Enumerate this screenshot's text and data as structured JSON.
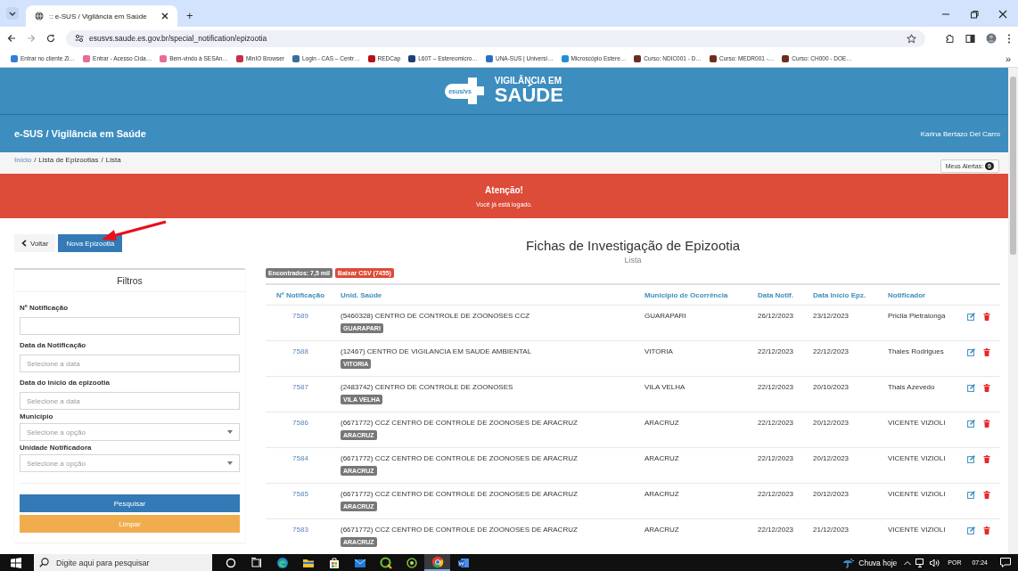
{
  "browser": {
    "tab": {
      "title": ":: e-SUS / Vigilância em Saúde",
      "selected": true
    },
    "new_tab": "+",
    "url": "esusvs.saude.es.gov.br/special_notification/epizootia",
    "bookmarks": [
      {
        "label": "Entrar no cliente Zi…",
        "color": "#2f7fd8"
      },
      {
        "label": "Entrar - Acesso Cida…",
        "color": "#e86a9a"
      },
      {
        "label": "Bem-vindo à SESAn…",
        "color": "#e86a9a"
      },
      {
        "label": "MinIO Browser",
        "color": "#c72e49"
      },
      {
        "label": "Login - CAS – Centr…",
        "color": "#3a6e9c"
      },
      {
        "label": "REDCap",
        "color": "#b5121b"
      },
      {
        "label": "L60T – Estereomicro…",
        "color": "#1f3f7a"
      },
      {
        "label": "UNA-SUS | Universi…",
        "color": "#2a6fbf"
      },
      {
        "label": "Microscópio Estere…",
        "color": "#1f8fd8"
      },
      {
        "label": "Curso: NDIC001 - D…",
        "color": "#6b2e1f"
      },
      {
        "label": "Curso: MEDR001 -…",
        "color": "#6b2e1f"
      },
      {
        "label": "Curso: CH000 - DOE…",
        "color": "#6b2e1f"
      }
    ],
    "more": "»"
  },
  "header": {
    "logo_mark": "esus/vs",
    "brand_top": "VIGILÂNCIA EM",
    "brand_bottom": "SAÚDE"
  },
  "navbar": {
    "title": "e-SUS / Vigilância em Saúde",
    "user": "Karina Bertazo Del Carro"
  },
  "breadcrumb": {
    "separator": "/",
    "items": [
      {
        "label": "Início",
        "link": true
      },
      {
        "label": "Lista de Epizootias",
        "link": false
      },
      {
        "label": "Lista",
        "link": false
      }
    ]
  },
  "alerts_button": {
    "label": "Meus Alertas:",
    "count": "0"
  },
  "alert": {
    "title": "Atenção!",
    "message": "Você já está logado."
  },
  "actions": [
    {
      "label": "Voltar",
      "kind": "back"
    },
    {
      "label": "Nova Epizootia",
      "kind": "primary"
    }
  ],
  "annotation": {
    "kind": "arrow"
  },
  "filters": {
    "title": "Filtros",
    "fields": [
      {
        "label": "Nº Notificação",
        "kind": "text"
      },
      {
        "label": "Data da Notificação",
        "kind": "date",
        "placeholder": "Selecione a data"
      },
      {
        "label": "Data do início da epizootia",
        "kind": "date",
        "placeholder": "Selecione a data"
      },
      {
        "label": "Município",
        "kind": "select",
        "placeholder": "Selecione a opção"
      },
      {
        "label": "Unidade Notificadora",
        "kind": "select",
        "placeholder": "Selecione a opção"
      }
    ],
    "buttons": [
      {
        "label": "Pesquisar",
        "kind": "primary"
      },
      {
        "label": "Limpar",
        "kind": "warning"
      }
    ]
  },
  "page_title": "Fichas de Investigação de Epizootia",
  "page_subtitle": "Lista",
  "badges": [
    {
      "label": "Encontrados: 7,5 mil",
      "kind": "count"
    },
    {
      "label": "Baixar CSV (7455)",
      "kind": "download"
    }
  ],
  "table": {
    "columns": [
      "Nº Notificação",
      "Unid. Saúde",
      "Municipio de Ocorrência",
      "Data Notif.",
      "Data Início Epz.",
      "Notificador"
    ],
    "rows": [
      {
        "number": "7589",
        "unit": "(5460328) CENTRO DE CONTROLE DE ZOONOSES CCZ",
        "tag": "GUARAPARI",
        "municipality": "GUARAPARI",
        "notified": "26/12/2023",
        "started": "23/12/2023",
        "notifier": "Pricila Pietralonga"
      },
      {
        "number": "7588",
        "unit": "(12467) CENTRO DE VIGILANCIA EM SAUDE AMBIENTAL",
        "tag": "VITORIA",
        "municipality": "VITORIA",
        "notified": "22/12/2023",
        "started": "22/12/2023",
        "notifier": "Thales Rodrigues"
      },
      {
        "number": "7587",
        "unit": "(2483742) CENTRO DE CONTROLE DE ZOONOSES",
        "tag": "VILA VELHA",
        "municipality": "VILA VELHA",
        "notified": "22/12/2023",
        "started": "20/10/2023",
        "notifier": "Thais Azevedo"
      },
      {
        "number": "7586",
        "unit": "(6671772) CCZ CENTRO DE CONTROLE DE ZOONOSES DE ARACRUZ",
        "tag": "ARACRUZ",
        "municipality": "ARACRUZ",
        "notified": "22/12/2023",
        "started": "20/12/2023",
        "notifier": "VICENTE VIZIOLI"
      },
      {
        "number": "7584",
        "unit": "(6671772) CCZ CENTRO DE CONTROLE DE ZOONOSES DE ARACRUZ",
        "tag": "ARACRUZ",
        "municipality": "ARACRUZ",
        "notified": "22/12/2023",
        "started": "20/12/2023",
        "notifier": "VICENTE VIZIOLI"
      },
      {
        "number": "7585",
        "unit": "(6671772) CCZ CENTRO DE CONTROLE DE ZOONOSES DE ARACRUZ",
        "tag": "ARACRUZ",
        "municipality": "ARACRUZ",
        "notified": "22/12/2023",
        "started": "20/12/2023",
        "notifier": "VICENTE VIZIOLI"
      },
      {
        "number": "7583",
        "unit": "(6671772) CCZ CENTRO DE CONTROLE DE ZOONOSES DE ARACRUZ",
        "tag": "ARACRUZ",
        "municipality": "ARACRUZ",
        "notified": "22/12/2023",
        "started": "21/12/2023",
        "notifier": "VICENTE VIZIOLI"
      }
    ]
  },
  "taskbar": {
    "search_placeholder": "Digite aqui para pesquisar",
    "apps": [
      {
        "kind": "circle",
        "selected": false
      },
      {
        "kind": "taskview",
        "selected": false
      },
      {
        "kind": "edge",
        "selected": false
      },
      {
        "kind": "folder",
        "selected": false
      },
      {
        "kind": "store",
        "selected": false
      },
      {
        "kind": "mail",
        "selected": false
      },
      {
        "kind": "qgis",
        "selected": false
      },
      {
        "kind": "ring",
        "selected": false
      },
      {
        "kind": "chrome",
        "selected": true
      },
      {
        "kind": "word",
        "selected": false
      }
    ],
    "weather": "Chuva hoje",
    "language": "POR",
    "time": "07:24"
  }
}
